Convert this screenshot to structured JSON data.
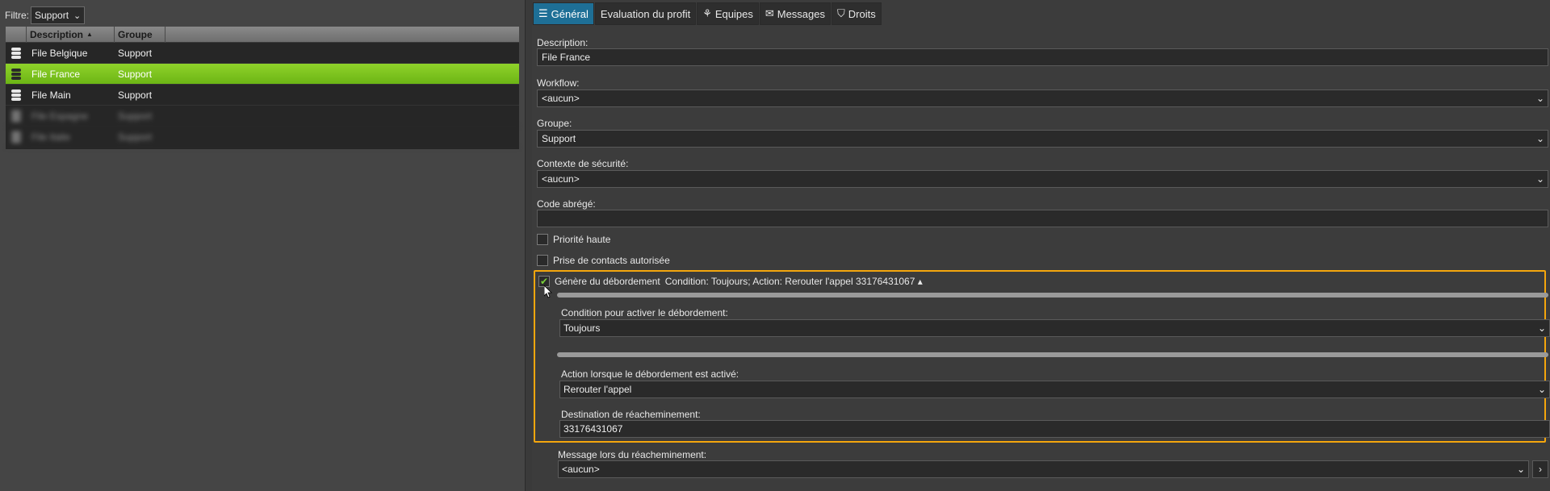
{
  "filter": {
    "label": "Filtre:",
    "value": "Support"
  },
  "grid": {
    "columns": [
      "Description",
      "Groupe"
    ],
    "rows": [
      {
        "description": "File Belgique",
        "group": "Support"
      },
      {
        "description": "File France",
        "group": "Support"
      },
      {
        "description": "File Main",
        "group": "Support"
      },
      {
        "description": "File Espagne",
        "group": "Support"
      },
      {
        "description": "File Italie",
        "group": "Support"
      }
    ]
  },
  "tabs": [
    {
      "label": "Général",
      "icon": "database-icon"
    },
    {
      "label": "Evaluation du profit",
      "icon": ""
    },
    {
      "label": "Equipes",
      "icon": "team-icon"
    },
    {
      "label": "Messages",
      "icon": "message-icon"
    },
    {
      "label": "Droits",
      "icon": "shield-icon"
    }
  ],
  "form": {
    "description": {
      "label": "Description:",
      "value": "File France"
    },
    "workflow": {
      "label": "Workflow:",
      "value": "<aucun>"
    },
    "groupe": {
      "label": "Groupe:",
      "value": "Support"
    },
    "contexte": {
      "label": "Contexte de sécurité:",
      "value": "<aucun>"
    },
    "code": {
      "label": "Code abrégé:",
      "value": ""
    },
    "priorite": {
      "label": "Priorité haute",
      "checked": false
    },
    "prise": {
      "label": "Prise de contacts autorisée",
      "checked": false
    },
    "debordement": {
      "label": "Génère du débordement",
      "summary": "Condition: Toujours; Action: Rerouter l'appel 33176431067 ▴",
      "checked": true,
      "condition": {
        "label": "Condition pour activer le débordement:",
        "value": "Toujours"
      },
      "action": {
        "label": "Action lorsque le débordement est activé:",
        "value": "Rerouter l'appel"
      },
      "destination": {
        "label": "Destination de réacheminement:",
        "value": "33176431067"
      }
    },
    "message": {
      "label": "Message lors du réacheminement:",
      "value": "<aucun>"
    }
  },
  "colors": {
    "accent": "#1e6f96",
    "selected_row": "#7cc31e",
    "highlight_border": "#f4a60d"
  }
}
